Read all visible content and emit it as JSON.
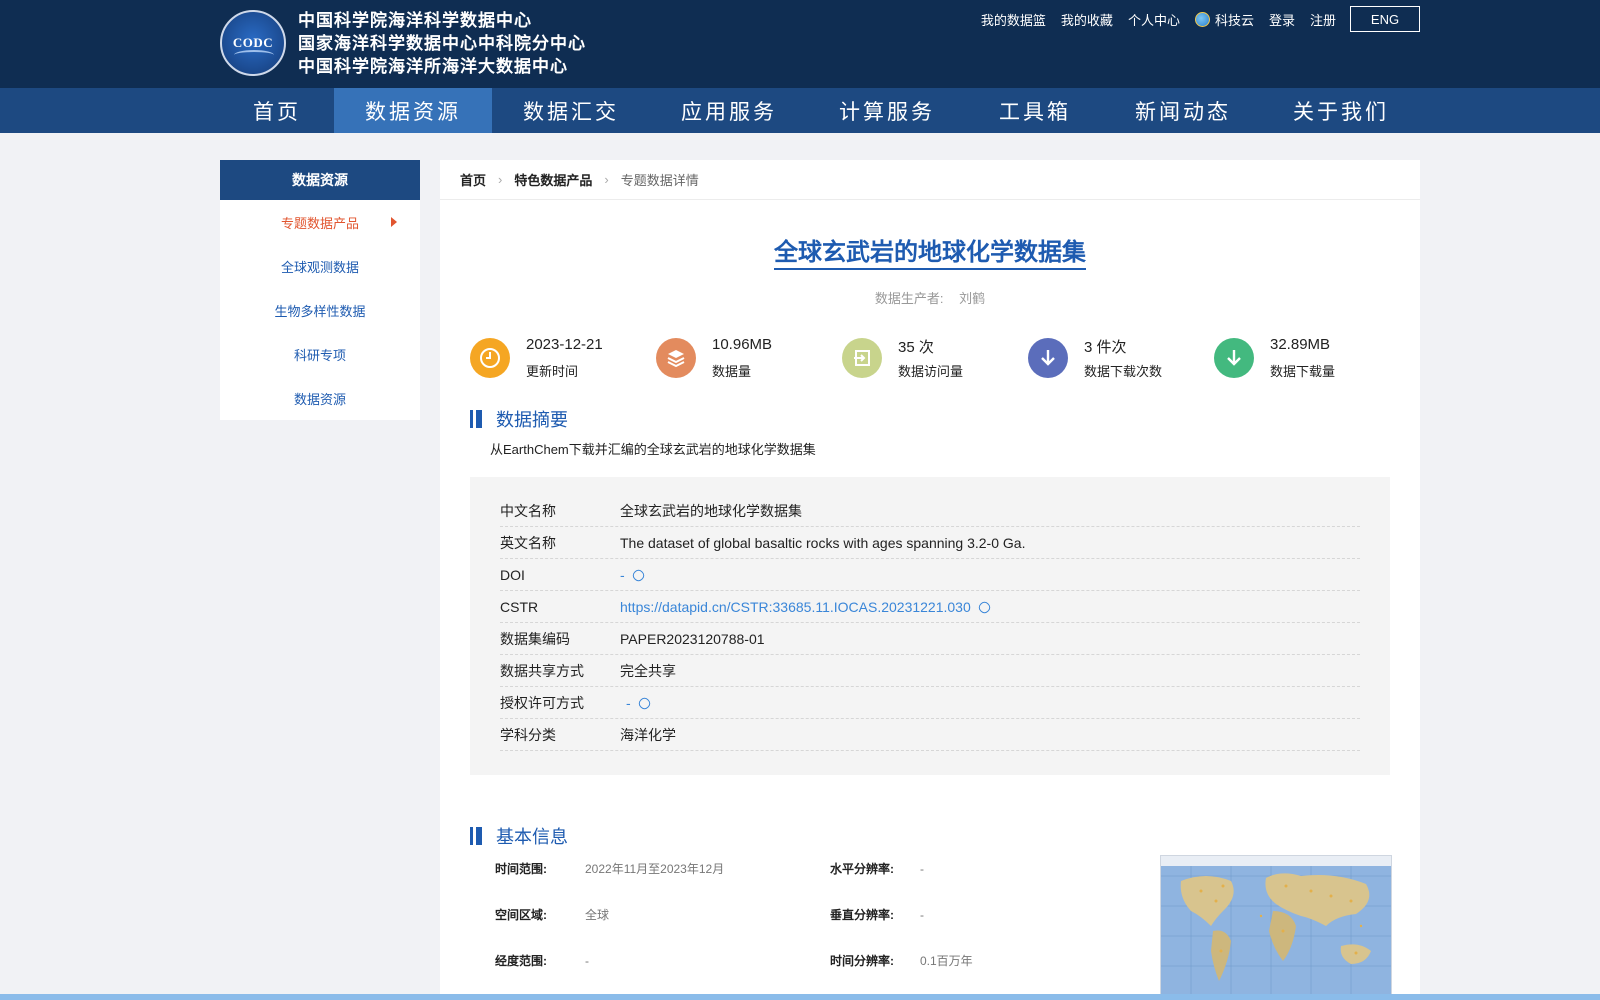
{
  "header": {
    "logo_text": "CODC",
    "org_names": [
      "中国科学院海洋科学数据中心",
      "国家海洋科学数据中心中科院分中心",
      "中国科学院海洋所海洋大数据中心"
    ],
    "top_links": [
      "我的数据篮",
      "我的收藏",
      "个人中心",
      "科技云",
      "登录",
      "注册"
    ],
    "lang_button": "ENG"
  },
  "mainnav": {
    "items": [
      "首页",
      "数据资源",
      "数据汇交",
      "应用服务",
      "计算服务",
      "工具箱",
      "新闻动态",
      "关于我们"
    ],
    "active": "数据资源"
  },
  "sidebar": {
    "title": "数据资源",
    "items": [
      "专题数据产品",
      "全球观测数据",
      "生物多样性数据",
      "科研专项",
      "数据资源"
    ]
  },
  "breadcrumb": {
    "home": "首页",
    "category": "特色数据产品",
    "current": "专题数据详情"
  },
  "dataset": {
    "title": "全球玄武岩的地球化学数据集",
    "producer_label": "数据生产者:",
    "producer": "刘鹤"
  },
  "stats": [
    {
      "value": "2023-12-21",
      "label": "更新时间",
      "icon": "clock-icon",
      "color": "#f5a623"
    },
    {
      "value": "10.96MB",
      "label": "数据量",
      "icon": "layers-icon",
      "color": "#e38b5e"
    },
    {
      "value": "35 次",
      "label": "数据访问量",
      "icon": "visit-icon",
      "color": "#c8d48c"
    },
    {
      "value": "3 件次",
      "label": "数据下载次数",
      "icon": "download-icon",
      "color": "#5b6dbb"
    },
    {
      "value": "32.89MB",
      "label": "数据下载量",
      "icon": "download-volume-icon",
      "color": "#43b97f"
    }
  ],
  "abstract": {
    "title": "数据摘要",
    "text": "从EarthChem下载并汇编的全球玄武岩的地球化学数据集"
  },
  "metadata": {
    "chinese_name_key": "中文名称",
    "chinese_name": "全球玄武岩的地球化学数据集",
    "english_name_key": "英文名称",
    "english_name": "The dataset of global basaltic rocks with ages spanning 3.2-0 Ga.",
    "doi_key": "DOI",
    "doi": "-",
    "cstr_key": "CSTR",
    "cstr": "https://datapid.cn/CSTR:33685.11.IOCAS.20231221.030",
    "code_key": "数据集编码",
    "code": "PAPER2023120788-01",
    "share_key": "数据共享方式",
    "share": "完全共享",
    "license_key": "授权许可方式",
    "license": "-",
    "subject_key": "学科分类",
    "subject": "海洋化学"
  },
  "basic_info": {
    "title": "基本信息",
    "time_range_key": "时间范围:",
    "time_range": "2022年11月至2023年12月",
    "h_res_key": "水平分辨率:",
    "h_res": "-",
    "region_key": "空间区域:",
    "region": "全球",
    "v_res_key": "垂直分辨率:",
    "v_res": "-",
    "lon_key": "经度范围:",
    "lon": "-",
    "t_res_key": "时间分辨率:",
    "t_res": "0.1百万年"
  },
  "colors": {
    "brand_dark": "#0f2d52",
    "nav": "#1d4981",
    "nav_active": "#3672b8",
    "accent": "#1e5bb0",
    "link": "#3a86d8"
  }
}
